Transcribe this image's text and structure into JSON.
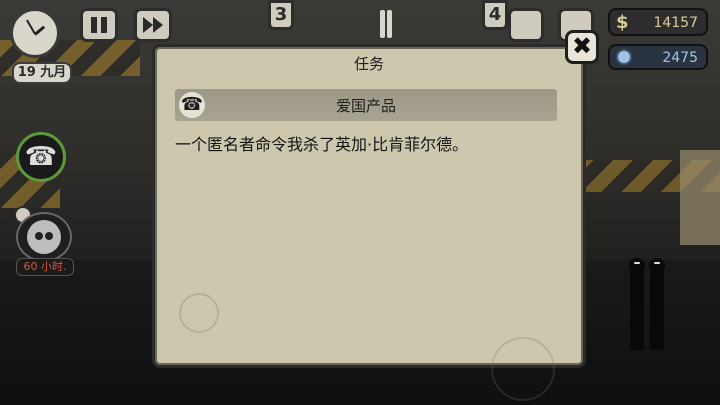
{
  "hud": {
    "date_label": "19 九月",
    "day_tag_left": "3",
    "day_tag_right": "4",
    "money_symbol": "$",
    "money_amount": "14157",
    "coins_amount": "2475"
  },
  "side": {
    "timer_label": "60 小时."
  },
  "dialog": {
    "title": "任务",
    "mission_icon": "phone-icon",
    "mission_name": "爱国产品",
    "mission_description": "一个匿名者命令我杀了英加·比肯菲尔德。",
    "close_symbol": "✖"
  },
  "colors": {
    "panel": "#cdc7ad",
    "mission_bar": "#a29d8a",
    "timer_text": "#d9553d",
    "money_text": "#d8cc9a",
    "coin_text": "#9ec3e6"
  }
}
